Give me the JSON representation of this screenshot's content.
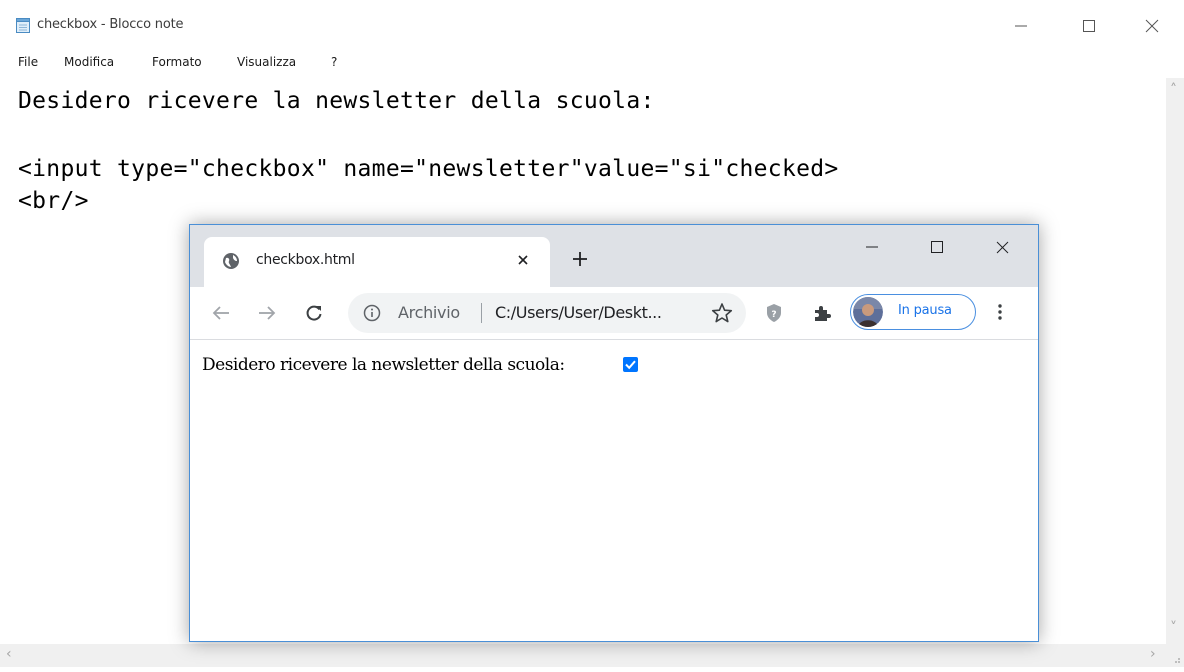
{
  "notepad": {
    "title": "checkbox - Blocco note",
    "menu": [
      "File",
      "Modifica",
      "Formato",
      "Visualizza",
      "?"
    ],
    "lines": [
      "Desidero ricevere la newsletter della scuola:",
      "",
      "<input type=\"checkbox\" name=\"newsletter\"value=\"si\"checked>",
      "<br/>"
    ],
    "icons": {
      "app": "notepad-icon",
      "minimize": "minimize-icon",
      "maximize": "maximize-icon",
      "close": "close-icon"
    }
  },
  "browser": {
    "tab_title": "checkbox.html",
    "new_tab_symbol": "+",
    "origin_chip": "Archivio",
    "url": "C:/Users/User/Deskt...",
    "profile_label": "In pausa",
    "icons": {
      "favicon": "globe-icon",
      "back": "back-arrow-icon",
      "forward": "forward-arrow-icon",
      "reload": "reload-icon",
      "info": "info-icon",
      "bookmark": "star-icon",
      "extension_shield": "shield-icon",
      "extensions": "puzzle-icon",
      "menu": "kebab-menu-icon"
    },
    "page": {
      "text": "Desidero ricevere la newsletter della scuola:",
      "checkbox_checked": true,
      "checkbox_color": "#0075ff"
    },
    "accent": "#1a73e8"
  }
}
